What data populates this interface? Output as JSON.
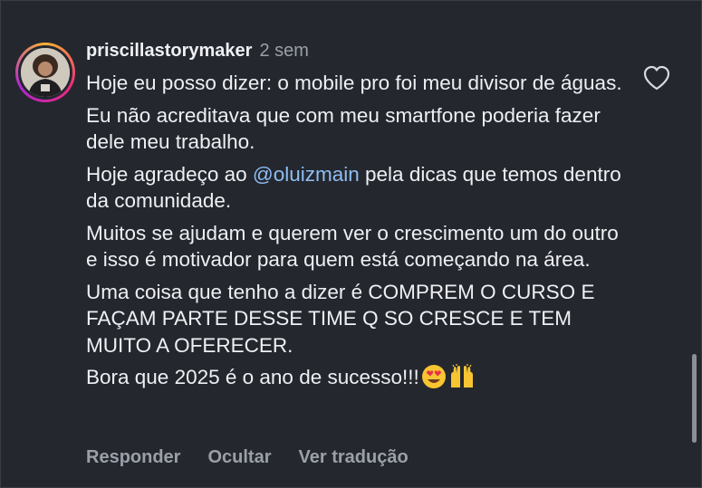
{
  "comment": {
    "username": "priscillastorymaker",
    "time": "2 sem",
    "p1": "Hoje eu posso dizer: o mobile pro foi meu divisor de águas.",
    "p2": "Eu não acreditava que com meu smartfone poderia fazer dele meu trabalho.",
    "p3_before": "Hoje agradeço ao ",
    "p3_mention": "@oluizmain",
    "p3_after": " pela dicas que temos dentro da comunidade.",
    "p4": "Muitos se ajudam e querem ver o crescimento um do outro e isso é motivador para quem está começando na área.",
    "p5": "Uma coisa que tenho a dizer é COMPREM O CURSO E FAÇAM PARTE DESSE TIME Q SO CRESCE E TEM MUITO A OFERECER.",
    "p6": "Bora que 2025 é o ano de sucesso!!!"
  },
  "emojis": [
    "heart-eyes-emoji",
    "raising-hands-emoji"
  ],
  "actions": {
    "reply": "Responder",
    "hide": "Ocultar",
    "translate": "Ver tradução"
  },
  "colors": {
    "background": "#24272e",
    "text": "#eef0f3",
    "muted": "#9ba0a8",
    "mention": "#8fbdf2"
  }
}
